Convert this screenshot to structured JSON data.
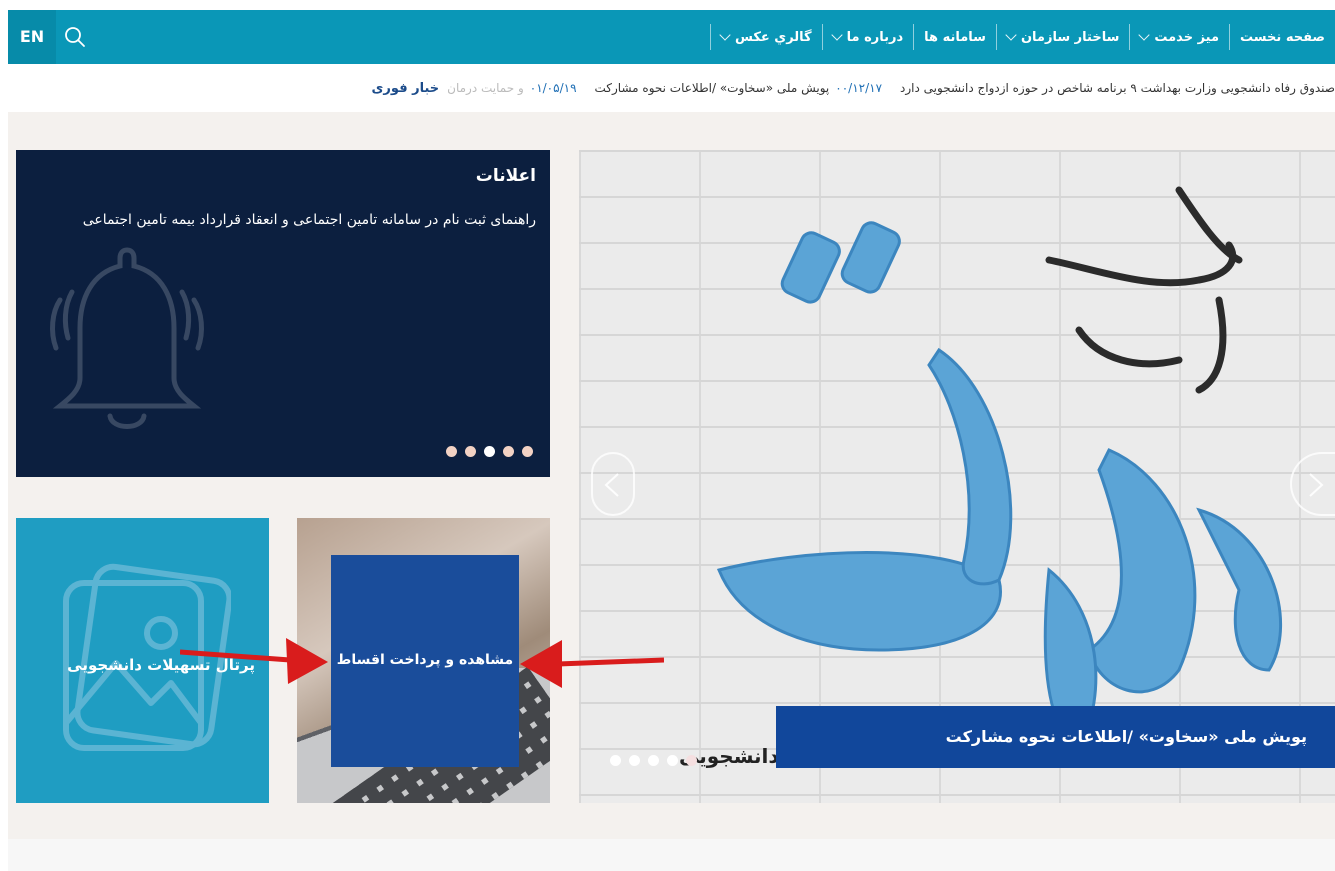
{
  "nav": {
    "lang": "EN",
    "items": [
      {
        "label": "صفحه نخست",
        "dropdown": false
      },
      {
        "label": "ميز خدمت",
        "dropdown": true
      },
      {
        "label": "ساختار سازمان",
        "dropdown": true
      },
      {
        "label": "سامانه ها",
        "dropdown": false
      },
      {
        "label": "درباره ما",
        "dropdown": true
      },
      {
        "label": "گالري عکس",
        "dropdown": true
      }
    ]
  },
  "ticker": {
    "label": "خبار فوری",
    "items": [
      {
        "text": "و حمایت درمان",
        "date": "",
        "faded": true
      },
      {
        "date": "۰۱/۰۵/۱۹",
        "text": "پویش ملی «سخاوت» /اطلاعات نحوه مشارکت"
      },
      {
        "date": "۰۰/۱۲/۱۷",
        "text": "صندوق رفاه دانشجویی وزارت بهداشت ۹ برنامه شاخص در حوزه ازدواج دانشجویی دارد"
      }
    ]
  },
  "announcement": {
    "title": "اعلانات",
    "text": "راهنمای ثبت نام در سامانه تامین اجتماعی و انعقاد قرارداد بیمه تامین اجتماعی",
    "dots": 5,
    "active_dot": 1
  },
  "slider": {
    "caption": "پویش ملی «سخاوت» /اطلاعات نحوه مشارکت",
    "subtitle": "دانشجویی",
    "dots": 5,
    "active_dot": 4
  },
  "tiles": {
    "portal_label": "پرتال تسهیلات دانشجویی",
    "payment_label": "مشاهده و پرداخت اقساط"
  },
  "colors": {
    "nav_bg": "#0a97b7",
    "announce_bg": "#0c1f3f",
    "caption_bg": "#11479b",
    "portal_bg": "#1f9dc2",
    "arrow": "#d91c1c"
  }
}
